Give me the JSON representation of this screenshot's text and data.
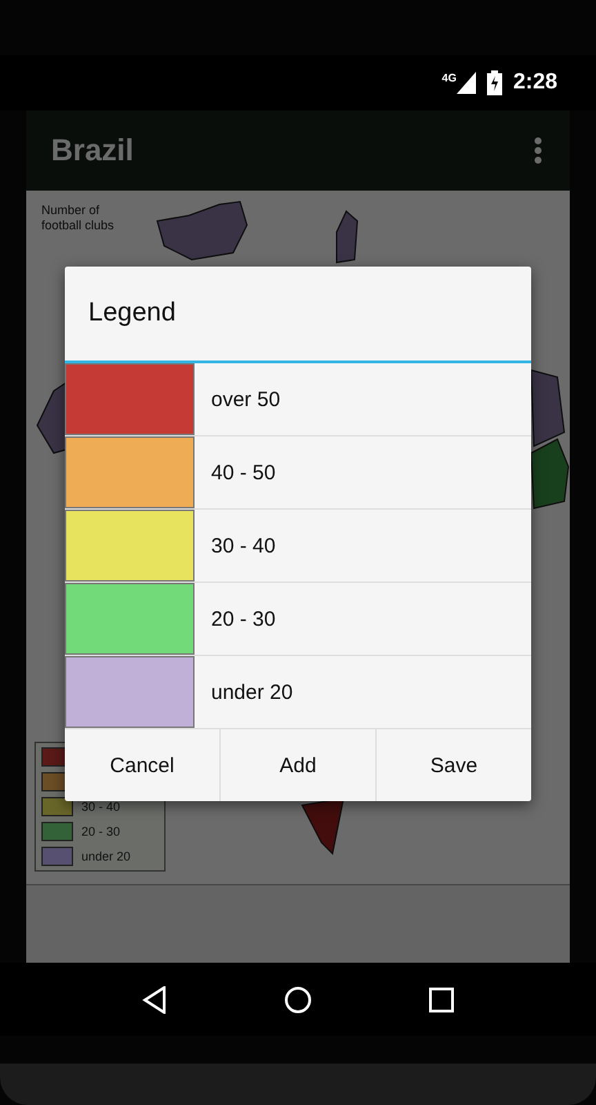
{
  "status_bar": {
    "network": "4G",
    "time": "2:28"
  },
  "app_bar": {
    "title": "Brazil"
  },
  "map": {
    "title": "Number of football clubs",
    "legend": [
      {
        "color": "#5a1a18"
      },
      {
        "color": "#6b4d26"
      },
      {
        "color": "#686628",
        "label": "30 - 40"
      },
      {
        "color": "#336238",
        "label": "20 - 30"
      },
      {
        "color": "#575070",
        "label": "under 20"
      }
    ]
  },
  "dialog": {
    "title": "Legend",
    "items": [
      {
        "color": "#c53a35",
        "label": "over 50"
      },
      {
        "color": "#eeac55",
        "label": "40 - 50"
      },
      {
        "color": "#e8e35f",
        "label": "30 - 40"
      },
      {
        "color": "#72da78",
        "label": "20 - 30"
      },
      {
        "color": "#c0b0d8",
        "label": "under 20"
      }
    ],
    "buttons": [
      "Cancel",
      "Add",
      "Save"
    ]
  }
}
